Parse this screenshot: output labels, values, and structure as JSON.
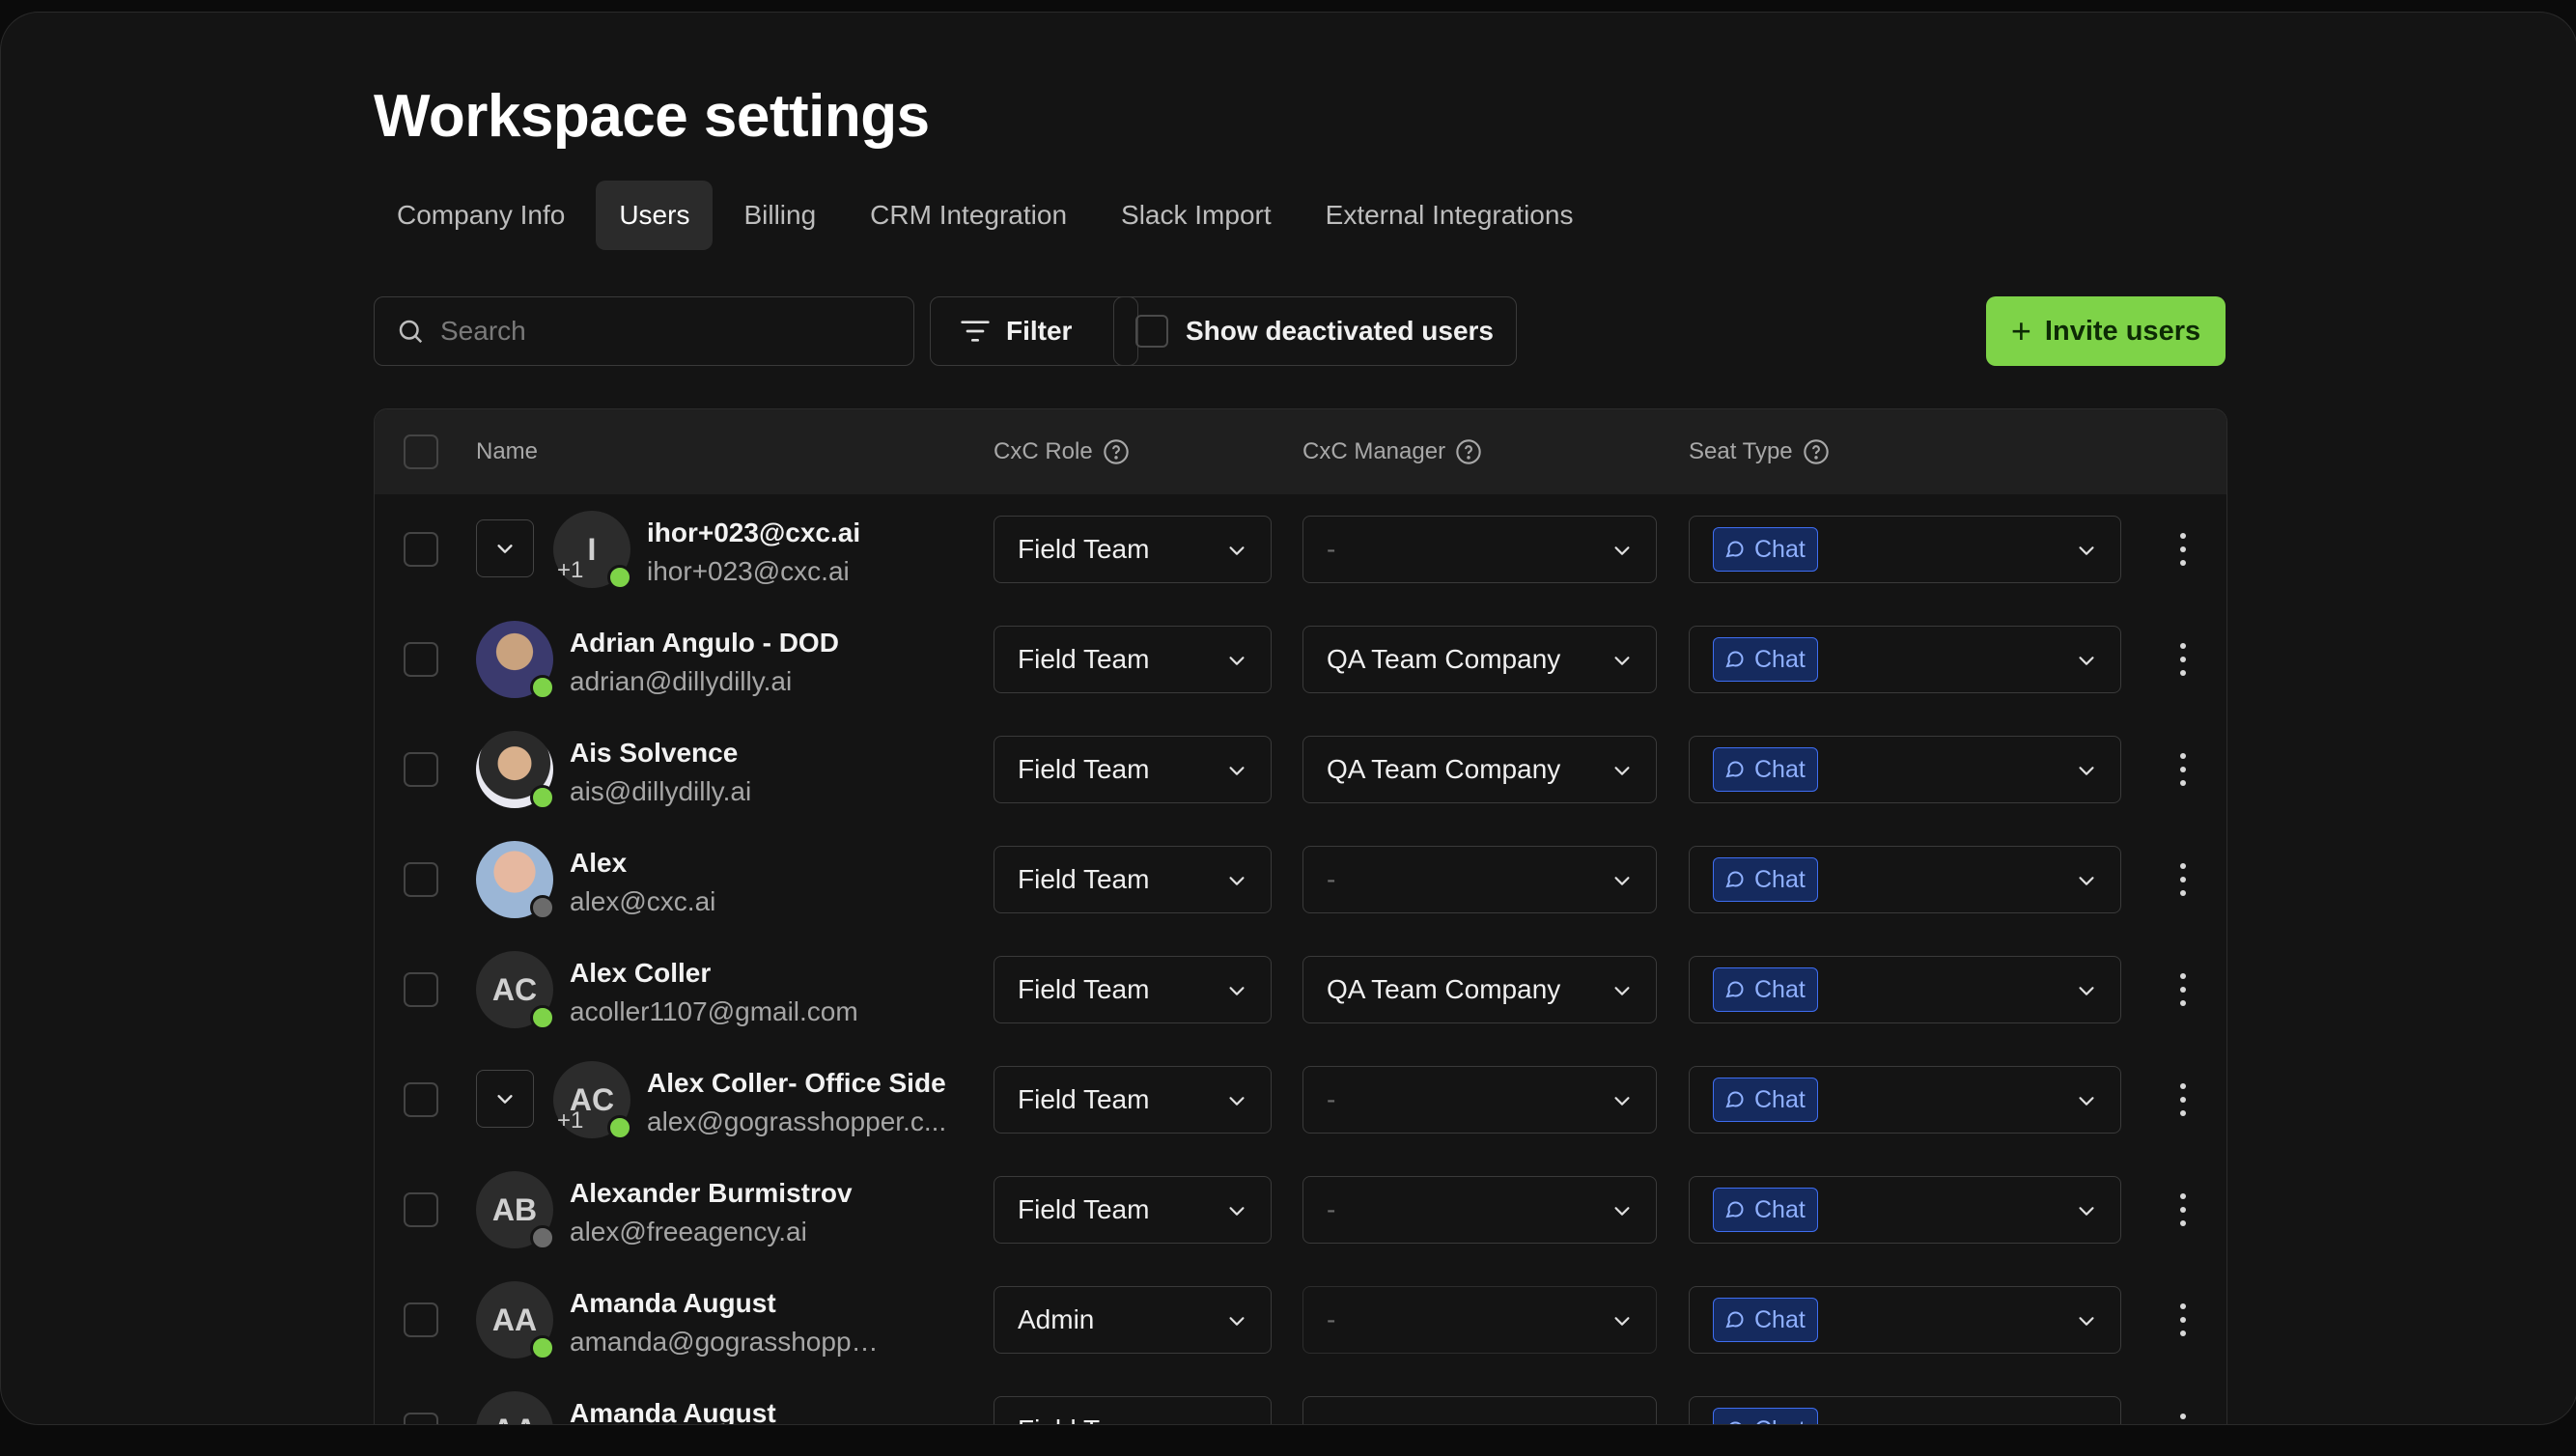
{
  "page": {
    "title": "Workspace settings"
  },
  "tabs": [
    {
      "label": "Company Info"
    },
    {
      "label": "Users"
    },
    {
      "label": "Billing"
    },
    {
      "label": "CRM Integration"
    },
    {
      "label": "Slack Import"
    },
    {
      "label": "External Integrations"
    }
  ],
  "active_tab": "Users",
  "toolbar": {
    "search_placeholder": "Search",
    "filter_label": "Filter",
    "show_deactivated_label": "Show deactivated users",
    "invite_label": "Invite users"
  },
  "table": {
    "columns": {
      "name": "Name",
      "role": "CxC Role",
      "manager": "CxC Manager",
      "seat": "Seat Type"
    },
    "rows": [
      {
        "name": "ihor+023@cxc.ai",
        "email": "ihor+023@cxc.ai",
        "initials": "I",
        "extra": "+1",
        "expandable": true,
        "status": "online",
        "role": "Field Team",
        "manager": "-",
        "seat": "Chat"
      },
      {
        "name": "Adrian Angulo - DOD",
        "email": "adrian@dillydilly.ai",
        "initials": "",
        "photo": "photo-1",
        "status": "online",
        "role": "Field Team",
        "manager": "QA Team Company",
        "seat": "Chat"
      },
      {
        "name": "Ais Solvence",
        "email": "ais@dillydilly.ai",
        "initials": "",
        "photo": "photo-2",
        "status": "online",
        "role": "Field Team",
        "manager": "QA Team Company",
        "seat": "Chat"
      },
      {
        "name": "Alex",
        "email": "alex@cxc.ai",
        "initials": "",
        "photo": "photo-3",
        "status": "offline",
        "role": "Field Team",
        "manager": "-",
        "seat": "Chat"
      },
      {
        "name": "Alex Coller",
        "email": "acoller1107@gmail.com",
        "initials": "AC",
        "status": "online",
        "role": "Field Team",
        "manager": "QA Team Company",
        "seat": "Chat"
      },
      {
        "name": "Alex Coller- Office Side",
        "email": "alex@gograsshopper.c...",
        "initials": "AC",
        "extra": "+1",
        "expandable": true,
        "status": "online",
        "role": "Field Team",
        "manager": "-",
        "seat": "Chat"
      },
      {
        "name": "Alexander Burmistrov",
        "email": "alex@freeagency.ai",
        "initials": "AB",
        "status": "offline",
        "role": "Field Team",
        "manager": "-",
        "seat": "Chat"
      },
      {
        "name": "Amanda August",
        "email": "amanda@gograsshopper.com",
        "initials": "AA",
        "status": "online",
        "role": "Admin",
        "manager": "-",
        "manager_disabled": true,
        "seat": "Chat"
      },
      {
        "name": "Amanda August",
        "email": "",
        "initials": "AA",
        "status": "online",
        "role": "Field Team",
        "manager": "-",
        "seat": "Chat"
      }
    ]
  },
  "colors": {
    "online": "#7ed348",
    "offline": "#6b6b6b",
    "accent": "#7ed348",
    "chat_badge": "#3f6df0"
  }
}
